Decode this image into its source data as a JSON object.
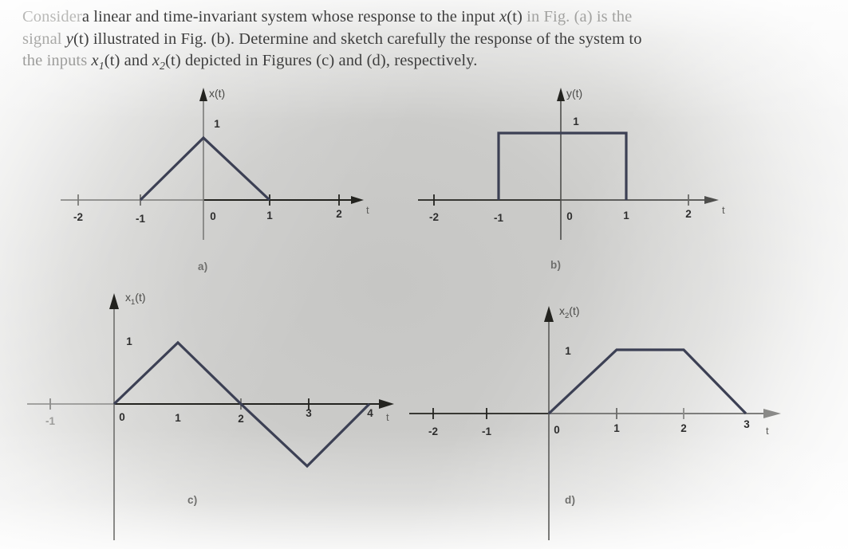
{
  "statement": {
    "line1": "Consider a linear and time-invariant system whose response to the input x(t) in Fig. (a) is the",
    "line2": "signal y(t) illustrated in Fig. (b). Determine and sketch carefully the response of the system to",
    "line3": "the inputs x₁(t) and x₂(t) depicted in Figures (c) and (d), respectively.",
    "segments": {
      "l1a": "Consider",
      "l1b": "a linear and time-invariant system whose response to the input ",
      "l1c": "x",
      "l1d": "(t)",
      "l1e": " in Fig. (a) is the",
      "l2a": "signal ",
      "l2b": "y",
      "l2c": "(t)",
      "l2d": " illustrated in Fig. (b). Determine and sketch carefully the response of the system to",
      "l3a": "the inputs ",
      "l3b": "x",
      "l3c": "1",
      "l3d": "(t)",
      "l3e": " and ",
      "l3f": "x",
      "l3g": "2",
      "l3h": "(t)",
      "l3i": " depicted in Figures (c) and (d), respectively."
    }
  },
  "colors": {
    "signal_stroke": "#3c4054",
    "axis_stroke": "#23231f",
    "axis_stroke_dim": "#7b7b79",
    "tick_label": "#2e2e2e",
    "tick_label_dim": "#9c9c9a",
    "caption": "#6f6f6d",
    "background_center": "#c6c6c4",
    "background_edge": "#f7f7f7"
  },
  "panels": [
    {
      "id": "a",
      "caption": "a)",
      "y_axis_label": "x(t)",
      "y_axis_label_base": "x",
      "y_axis_label_sub": "",
      "x_axis_label": "t",
      "value_label": "1",
      "tick_labels": [
        "-2",
        "-1",
        "0",
        "1",
        "2"
      ],
      "tick_values": [
        -2,
        -1,
        0,
        1,
        2
      ],
      "ticks_drawn": [
        -2,
        -1,
        1,
        2
      ],
      "chart_data": {
        "type": "line",
        "title": "x(t)",
        "xlabel": "t",
        "ylabel": "x(t)",
        "xlim": [
          -2.6,
          2.9
        ],
        "ylim": [
          -0.45,
          1.35
        ],
        "grid": false,
        "legend": "none",
        "x": [
          -2.6,
          -1,
          0,
          1,
          2.9
        ],
        "y": [
          0,
          0,
          1,
          0,
          0
        ],
        "annotations": [
          "peak value 1 at t = 0",
          "triangular pulse on [-1, 1]"
        ]
      }
    },
    {
      "id": "b",
      "caption": "b)",
      "y_axis_label": "y(t)",
      "y_axis_label_base": "y",
      "y_axis_label_sub": "",
      "x_axis_label": "t",
      "value_label": "1",
      "tick_labels": [
        "-2",
        "-1",
        "0",
        "1",
        "2"
      ],
      "tick_values": [
        -2,
        -1,
        0,
        1,
        2
      ],
      "ticks_drawn": [
        -2,
        2
      ],
      "chart_data": {
        "type": "line",
        "title": "y(t)",
        "xlabel": "t",
        "ylabel": "y(t)",
        "xlim": [
          -2.6,
          2.9
        ],
        "ylim": [
          -0.45,
          1.35
        ],
        "grid": false,
        "legend": "none",
        "x": [
          -2.6,
          -1,
          -1,
          1,
          1,
          2.9
        ],
        "y": [
          0,
          0,
          1,
          1,
          0,
          0
        ],
        "annotations": [
          "rectangular pulse of height 1 on [-1, 1]"
        ]
      }
    },
    {
      "id": "c",
      "caption": "c)",
      "y_axis_label": "x₁(t)",
      "y_axis_label_base": "x",
      "y_axis_label_sub": "1",
      "x_axis_label": "t",
      "value_label": "1",
      "tick_labels": [
        "-1",
        "0",
        "1",
        "2",
        "3",
        "4"
      ],
      "tick_values": [
        -1,
        0,
        1,
        2,
        3,
        4
      ],
      "ticks_drawn": [
        -1,
        2,
        3
      ],
      "chart_data": {
        "type": "line",
        "title": "x1(t)",
        "xlabel": "t",
        "ylabel": "x1(t)",
        "xlim": [
          -1.5,
          4.5
        ],
        "ylim": [
          -1.35,
          1.35
        ],
        "grid": false,
        "legend": "none",
        "x": [
          -1.5,
          0,
          1,
          2,
          3,
          4
        ],
        "y": [
          0,
          0,
          1,
          0,
          -1,
          0
        ],
        "annotations": [
          "triangular wave: +1 peak at t = 1, -1 trough at t = 3"
        ]
      }
    },
    {
      "id": "d",
      "caption": "d)",
      "y_axis_label": "x₂(t)",
      "y_axis_label_base": "x",
      "y_axis_label_sub": "2",
      "x_axis_label": "t",
      "value_label": "1",
      "tick_labels": [
        "-2",
        "-1",
        "0",
        "1",
        "2",
        "3"
      ],
      "tick_values": [
        -2,
        -1,
        0,
        1,
        2,
        3
      ],
      "ticks_drawn": [
        -2,
        -1,
        1,
        2
      ],
      "chart_data": {
        "type": "line",
        "title": "x2(t)",
        "xlabel": "t",
        "ylabel": "x2(t)",
        "xlim": [
          -2.6,
          3.6
        ],
        "ylim": [
          -0.45,
          1.35
        ],
        "grid": false,
        "legend": "none",
        "x": [
          -2.6,
          0,
          1,
          2,
          3
        ],
        "y": [
          0,
          0,
          1,
          1,
          0
        ],
        "annotations": [
          "trapezoid: ramp up 0→1, plateau at 1 on [1,2], ramp down to 0 at t = 3"
        ]
      }
    }
  ]
}
